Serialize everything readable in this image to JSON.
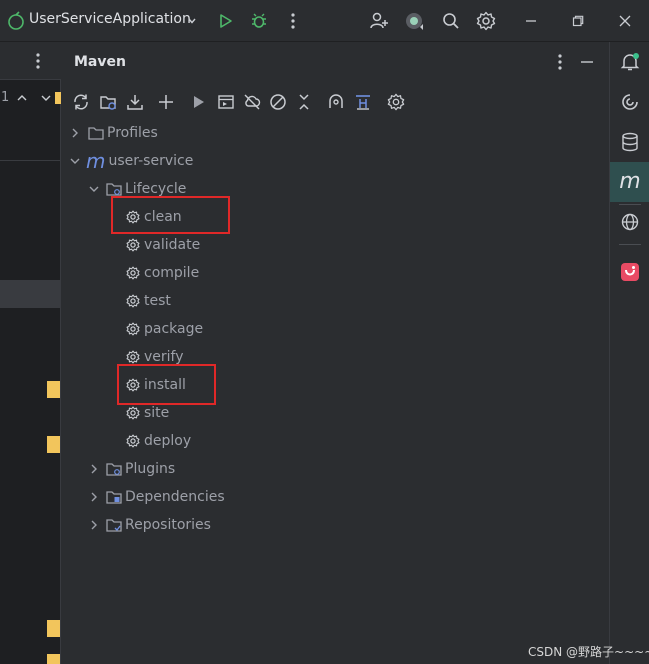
{
  "window": {
    "app_name": "UserServiceApplication"
  },
  "editor": {
    "gutter_line": "1"
  },
  "maven": {
    "title": "Maven",
    "tree": {
      "profiles": "Profiles",
      "project": "user-service",
      "lifecycle": "Lifecycle",
      "phases": [
        "clean",
        "validate",
        "compile",
        "test",
        "package",
        "verify",
        "install",
        "site",
        "deploy"
      ],
      "plugins": "Plugins",
      "dependencies": "Dependencies",
      "repositories": "Repositories"
    },
    "highlighted_phases": [
      "clean",
      "install"
    ]
  },
  "right_strip": {
    "active_tool_letter": "m"
  },
  "watermark": "CSDN @野路子~~~~",
  "colors": {
    "background": "#2b2d30",
    "editor_background": "#1e1f22",
    "highlight_box": "#e02828",
    "run_green": "#4eb86a",
    "maven_blue": "#6f8fe0",
    "bookmark_yellow": "#f2c55c",
    "notification_dot": "#3cc08c"
  }
}
